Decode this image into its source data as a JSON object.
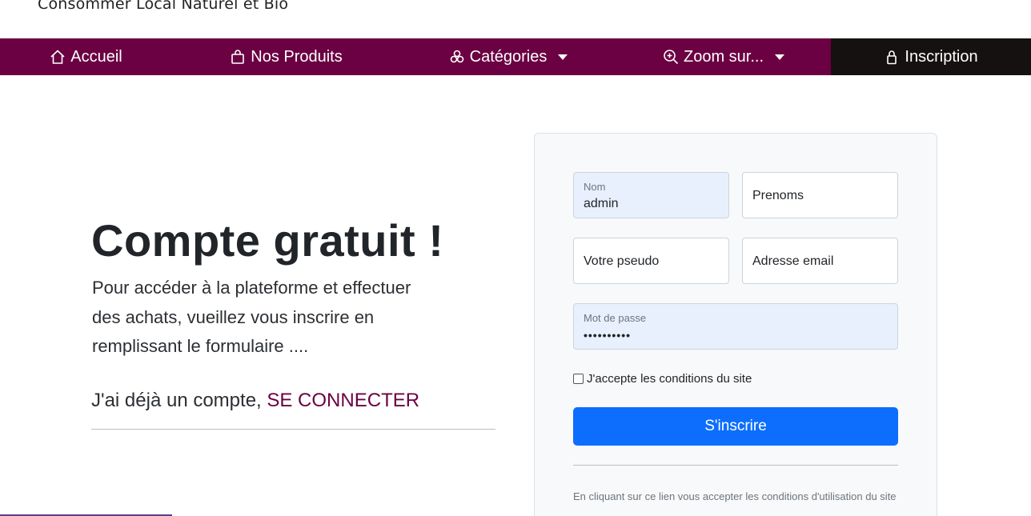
{
  "brand": {
    "text": "Consommer Local Naturel et Bio"
  },
  "nav": {
    "items": [
      {
        "label": "Accueil",
        "icon": "home-icon"
      },
      {
        "label": "Nos Produits",
        "icon": "shopping-bag-icon"
      },
      {
        "label": "Catégories",
        "icon": "categories-icon",
        "dropdown": true
      },
      {
        "label": "Zoom sur...",
        "icon": "zoom-in-icon",
        "dropdown": true
      },
      {
        "label": "Inscription",
        "icon": "lock-icon"
      }
    ],
    "colors": {
      "bar": "#6b0042",
      "active": "#151111"
    }
  },
  "hero": {
    "title": "Compte gratuit !",
    "text": "Pour accéder à la plateforme et effectuer des achats, vueillez vous inscrire en remplissant le formulaire ....",
    "login_prefix": "J'ai déjà un compte, ",
    "login_link": "SE CONNECTER"
  },
  "form": {
    "nom": {
      "label": "Nom",
      "value": "admin"
    },
    "prenoms": {
      "placeholder": "Prenoms"
    },
    "pseudo": {
      "placeholder": "Votre pseudo"
    },
    "email": {
      "placeholder": "Adresse email"
    },
    "password": {
      "label": "Mot de passe",
      "value": "••••••••••"
    },
    "accept_label": "J'accepte les conditions du site",
    "submit_label": "S'inscrire",
    "note": "En cliquant sur ce lien vous accepter les conditions d'utilisation du site",
    "colors": {
      "submit": "#0d6efd",
      "autofill": "#e8f0fe"
    }
  }
}
